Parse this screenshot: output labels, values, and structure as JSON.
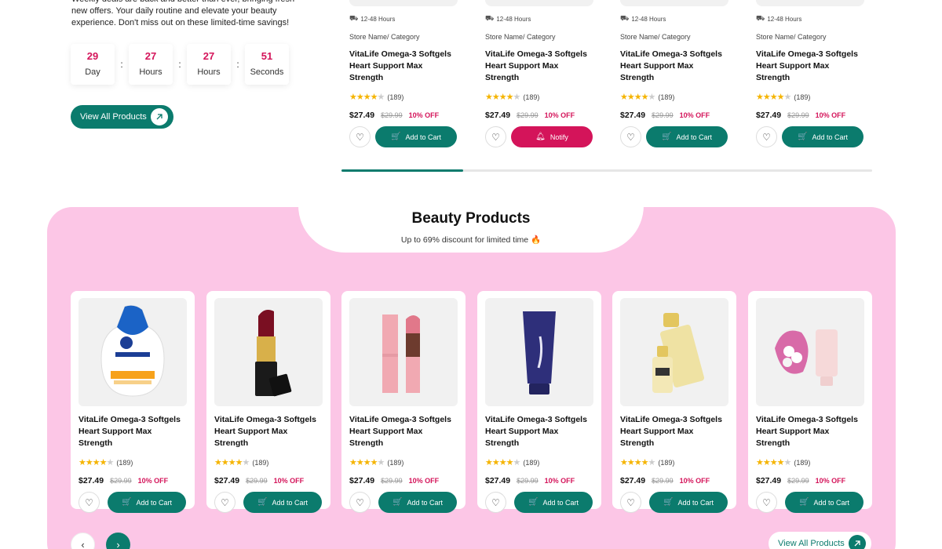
{
  "deals": {
    "description": "Weekly deals are back and better than ever, bringing fresh new offers. Your daily routine and elevate your beauty experience. Don't miss out on these limited-time savings!",
    "countdown": [
      {
        "value": "29",
        "label": "Day"
      },
      {
        "value": "27",
        "label": "Hours"
      },
      {
        "value": "27",
        "label": "Hours"
      },
      {
        "value": "51",
        "label": "Seconds"
      }
    ],
    "separator": ":",
    "view_all_label": "View All Products",
    "carousel_progress": 0.23,
    "products": [
      {
        "shipping": "12-48 Hours",
        "store": "Store Name/ Category",
        "name_line1": "VitaLife Omega-3 Softgels",
        "name_line2": "Heart Support Max Strength",
        "reviews": "(189)",
        "rating": 4,
        "price": "$27.49",
        "old_price": "$29.99",
        "discount": "10% OFF",
        "action": "Add to Cart"
      },
      {
        "shipping": "12-48 Hours",
        "store": "Store Name/ Category",
        "name_line1": "VitaLife Omega-3 Softgels",
        "name_line2": "Heart Support Max Strength",
        "reviews": "(189)",
        "rating": 4,
        "price": "$27.49",
        "old_price": "$29.99",
        "discount": "10% OFF",
        "action": "Notify"
      },
      {
        "shipping": "12-48 Hours",
        "store": "Store Name/ Category",
        "name_line1": "VitaLife Omega-3 Softgels",
        "name_line2": "Heart Support Max Strength",
        "reviews": "(189)",
        "rating": 4,
        "price": "$27.49",
        "old_price": "$29.99",
        "discount": "10% OFF",
        "action": "Add to Cart"
      },
      {
        "shipping": "12-48 Hours",
        "store": "Store Name/ Category",
        "name_line1": "VitaLife Omega-3 Softgels",
        "name_line2": "Heart Support Max Strength",
        "reviews": "(189)",
        "rating": 4,
        "price": "$27.49",
        "old_price": "$29.99",
        "discount": "10% OFF",
        "action": "Add to Cart"
      }
    ]
  },
  "beauty": {
    "title": "Beauty Products",
    "subtitle": "Up to 69% discount for limited time 🔥",
    "view_all_label": "View All Products",
    "products": [
      {
        "image": "face-wash-bottle",
        "name_line1": "VitaLife Omega-3 Softgels",
        "name_line2": "Heart Support Max Strength",
        "reviews": "(189)",
        "rating": 4,
        "price": "$27.49",
        "old_price": "$29.99",
        "discount": "10% OFF",
        "action": "Add to Cart"
      },
      {
        "image": "red-lipstick",
        "name_line1": "VitaLife Omega-3 Softgels",
        "name_line2": "Heart Support Max Strength",
        "reviews": "(189)",
        "rating": 4,
        "price": "$27.49",
        "old_price": "$29.99",
        "discount": "10% OFF",
        "action": "Add to Cart"
      },
      {
        "image": "pink-lipstick",
        "name_line1": "VitaLife Omega-3 Softgels",
        "name_line2": "Heart Support Max Strength",
        "reviews": "(189)",
        "rating": 4,
        "price": "$27.49",
        "old_price": "$29.99",
        "discount": "10% OFF",
        "action": "Add to Cart"
      },
      {
        "image": "cream-tube",
        "name_line1": "VitaLife Omega-3 Softgels",
        "name_line2": "Heart Support Max Strength",
        "reviews": "(189)",
        "rating": 4,
        "price": "$27.49",
        "old_price": "$29.99",
        "discount": "10% OFF",
        "action": "Add to Cart"
      },
      {
        "image": "serum-bottles",
        "name_line1": "VitaLife Omega-3 Softgels",
        "name_line2": "Heart Support Max Strength",
        "reviews": "(189)",
        "rating": 4,
        "price": "$27.49",
        "old_price": "$29.99",
        "discount": "10% OFF",
        "action": "Add to Cart"
      },
      {
        "image": "cotton-balls-and-tube",
        "name_line1": "VitaLife Omega-3 Softgels",
        "name_line2": "Heart Support Max Strength",
        "reviews": "(189)",
        "rating": 4,
        "price": "$27.49",
        "old_price": "$29.99",
        "discount": "10% OFF",
        "action": "Add to Cart"
      }
    ]
  },
  "colors": {
    "accent": "#0b7b6d",
    "sale": "#d4145a",
    "pink_bg": "#fcc6e6",
    "star": "#f5b400"
  },
  "icons": {
    "truck": "truck-icon",
    "heart": "heart-icon",
    "cart": "cart-icon",
    "bell": "bell-icon",
    "arrow": "arrow-up-right-icon",
    "prev": "chevron-left-icon",
    "next": "chevron-right-icon"
  }
}
